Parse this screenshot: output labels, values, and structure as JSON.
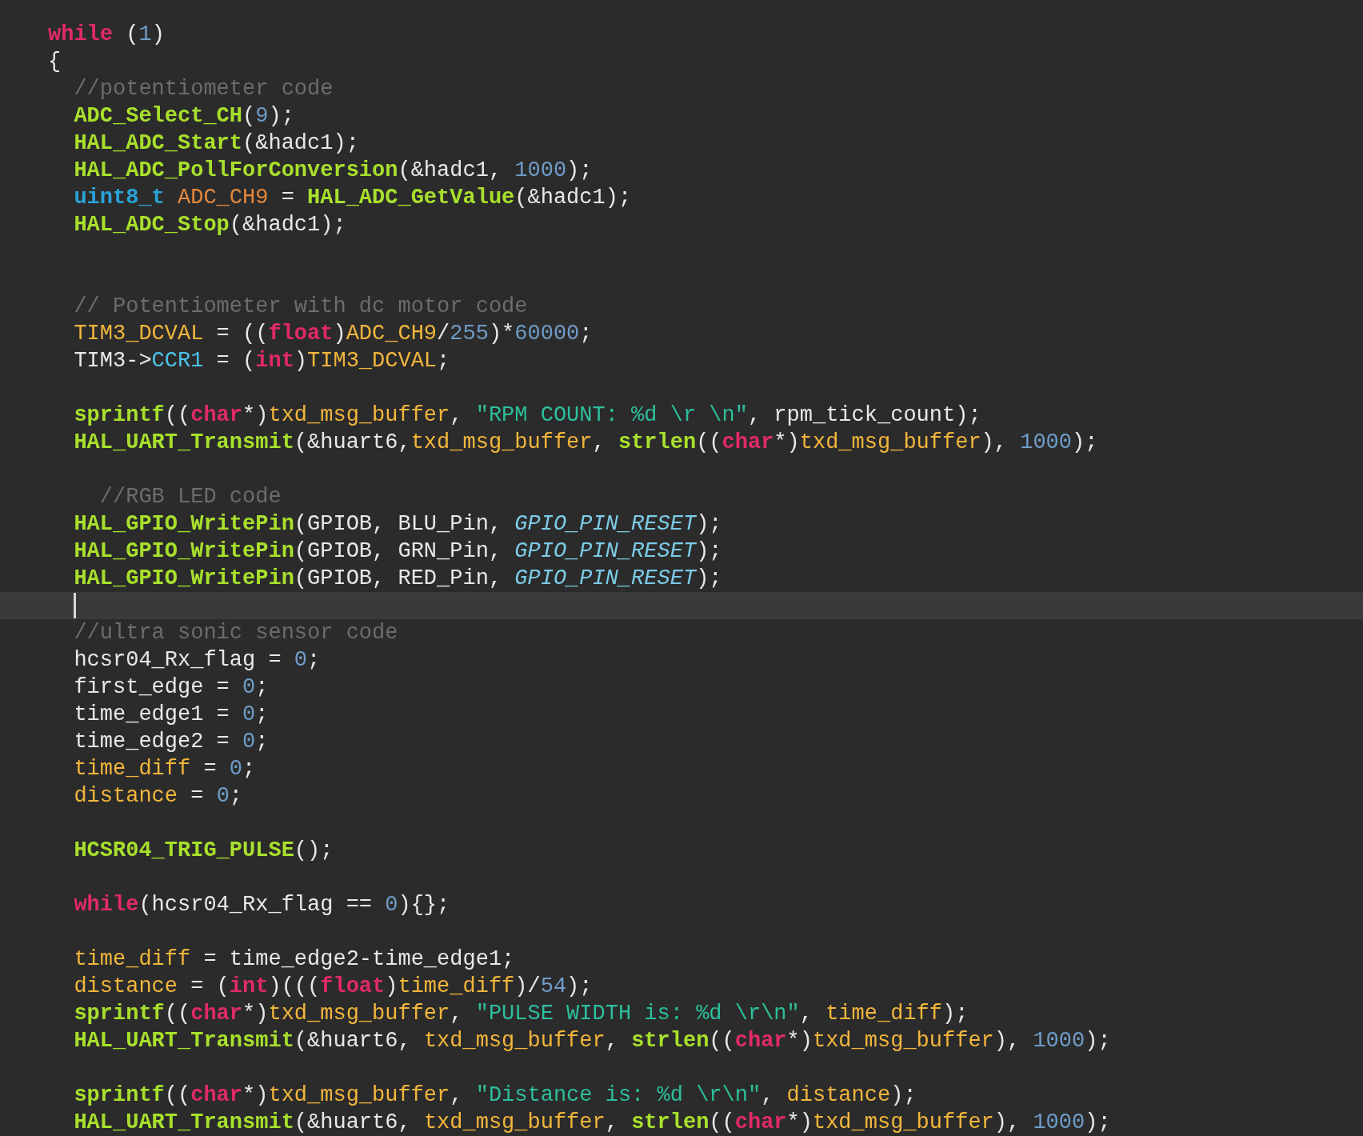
{
  "editor": {
    "lines": [
      {
        "kind": "code",
        "tokens": [
          {
            "text": "while",
            "kind": "keyword"
          },
          {
            "text": " (",
            "kind": "plain"
          },
          {
            "text": "1",
            "kind": "number"
          },
          {
            "text": ")",
            "kind": "plain"
          }
        ]
      },
      {
        "kind": "code",
        "tokens": [
          {
            "text": "{",
            "kind": "plain"
          }
        ],
        "children": [
          {
            "kind": "code",
            "tokens": [
              {
                "text": "//potentiometer code",
                "kind": "comment"
              }
            ]
          },
          {
            "kind": "code",
            "tokens": [
              {
                "text": "ADC_Select_CH",
                "kind": "function"
              },
              {
                "text": "(",
                "kind": "plain"
              },
              {
                "text": "9",
                "kind": "number"
              },
              {
                "text": ");",
                "kind": "plain"
              }
            ]
          },
          {
            "kind": "code",
            "tokens": [
              {
                "text": "HAL_ADC_Start",
                "kind": "function"
              },
              {
                "text": "(&hadc1);",
                "kind": "plain"
              }
            ]
          },
          {
            "kind": "code",
            "tokens": [
              {
                "text": "HAL_ADC_PollForConversion",
                "kind": "function"
              },
              {
                "text": "(&hadc1, ",
                "kind": "plain"
              },
              {
                "text": "1000",
                "kind": "number"
              },
              {
                "text": ");",
                "kind": "plain"
              }
            ]
          },
          {
            "kind": "code",
            "tokens": [
              {
                "text": "uint8_t",
                "kind": "type"
              },
              {
                "text": " ADC_CH9",
                "kind": "local"
              },
              {
                "text": " = ",
                "kind": "plain"
              },
              {
                "text": "HAL_ADC_GetValue",
                "kind": "function"
              },
              {
                "text": "(&hadc1);",
                "kind": "plain"
              }
            ]
          },
          {
            "kind": "code",
            "tokens": [
              {
                "text": "HAL_ADC_Stop",
                "kind": "function"
              },
              {
                "text": "(&hadc1);",
                "kind": "plain"
              }
            ]
          },
          {
            "kind": "blank"
          },
          {
            "kind": "blank"
          },
          {
            "kind": "code",
            "tokens": [
              {
                "text": "// Potentiometer with dc motor code",
                "kind": "comment"
              }
            ]
          },
          {
            "kind": "code",
            "tokens": [
              {
                "text": "TIM3_DCVAL",
                "kind": "global"
              },
              {
                "text": " = ((",
                "kind": "plain"
              },
              {
                "text": "float",
                "kind": "keyword"
              },
              {
                "text": ")",
                "kind": "plain"
              },
              {
                "text": "ADC_CH9",
                "kind": "global"
              },
              {
                "text": "/",
                "kind": "plain"
              },
              {
                "text": "255",
                "kind": "number"
              },
              {
                "text": ")*",
                "kind": "plain"
              },
              {
                "text": "60000",
                "kind": "number"
              },
              {
                "text": ";",
                "kind": "plain"
              }
            ]
          },
          {
            "kind": "code",
            "tokens": [
              {
                "text": "TIM3->",
                "kind": "plain"
              },
              {
                "text": "CCR1",
                "kind": "field"
              },
              {
                "text": " = (",
                "kind": "plain"
              },
              {
                "text": "int",
                "kind": "keyword"
              },
              {
                "text": ")",
                "kind": "plain"
              },
              {
                "text": "TIM3_DCVAL",
                "kind": "global"
              },
              {
                "text": ";",
                "kind": "plain"
              }
            ]
          },
          {
            "kind": "blank"
          },
          {
            "kind": "code",
            "tokens": [
              {
                "text": "sprintf",
                "kind": "function"
              },
              {
                "text": "((",
                "kind": "plain"
              },
              {
                "text": "char",
                "kind": "keyword"
              },
              {
                "text": "*)",
                "kind": "plain"
              },
              {
                "text": "txd_msg_buffer",
                "kind": "global"
              },
              {
                "text": ", ",
                "kind": "plain"
              },
              {
                "text": "\"RPM COUNT: %d \\r \\n\"",
                "kind": "string"
              },
              {
                "text": ", rpm_tick_count);",
                "kind": "plain"
              }
            ]
          },
          {
            "kind": "code",
            "tokens": [
              {
                "text": "HAL_UART_Transmit",
                "kind": "function"
              },
              {
                "text": "(&huart6,",
                "kind": "plain"
              },
              {
                "text": "txd_msg_buffer",
                "kind": "global"
              },
              {
                "text": ", ",
                "kind": "plain"
              },
              {
                "text": "strlen",
                "kind": "function"
              },
              {
                "text": "((",
                "kind": "plain"
              },
              {
                "text": "char",
                "kind": "keyword"
              },
              {
                "text": "*)",
                "kind": "plain"
              },
              {
                "text": "txd_msg_buffer",
                "kind": "global"
              },
              {
                "text": "), ",
                "kind": "plain"
              },
              {
                "text": "1000",
                "kind": "number"
              },
              {
                "text": ");",
                "kind": "plain"
              }
            ]
          },
          {
            "kind": "blank"
          },
          {
            "kind": "code",
            "extra_indent": true,
            "tokens": [
              {
                "text": "//RGB LED code",
                "kind": "comment"
              }
            ]
          },
          {
            "kind": "code",
            "tokens": [
              {
                "text": "HAL_GPIO_WritePin",
                "kind": "function"
              },
              {
                "text": "(GPIOB, BLU_Pin, ",
                "kind": "plain"
              },
              {
                "text": "GPIO_PIN_RESET",
                "kind": "constant"
              },
              {
                "text": ");",
                "kind": "plain"
              }
            ]
          },
          {
            "kind": "code",
            "tokens": [
              {
                "text": "HAL_GPIO_WritePin",
                "kind": "function"
              },
              {
                "text": "(GPIOB, GRN_Pin, ",
                "kind": "plain"
              },
              {
                "text": "GPIO_PIN_RESET",
                "kind": "constant"
              },
              {
                "text": ");",
                "kind": "plain"
              }
            ]
          },
          {
            "kind": "code",
            "tokens": [
              {
                "text": "HAL_GPIO_WritePin",
                "kind": "function"
              },
              {
                "text": "(GPIOB, RED_Pin, ",
                "kind": "plain"
              },
              {
                "text": "GPIO_PIN_RESET",
                "kind": "constant"
              },
              {
                "text": ");",
                "kind": "plain"
              }
            ]
          },
          {
            "kind": "cursor"
          },
          {
            "kind": "code",
            "tokens": [
              {
                "text": "//ultra sonic sensor code",
                "kind": "comment"
              }
            ]
          },
          {
            "kind": "code",
            "tokens": [
              {
                "text": "hcsr04_Rx_flag = ",
                "kind": "plain"
              },
              {
                "text": "0",
                "kind": "number"
              },
              {
                "text": ";",
                "kind": "plain"
              }
            ]
          },
          {
            "kind": "code",
            "tokens": [
              {
                "text": "first_edge = ",
                "kind": "plain"
              },
              {
                "text": "0",
                "kind": "number"
              },
              {
                "text": ";",
                "kind": "plain"
              }
            ]
          },
          {
            "kind": "code",
            "tokens": [
              {
                "text": "time_edge1 = ",
                "kind": "plain"
              },
              {
                "text": "0",
                "kind": "number"
              },
              {
                "text": ";",
                "kind": "plain"
              }
            ]
          },
          {
            "kind": "code",
            "tokens": [
              {
                "text": "time_edge2 = ",
                "kind": "plain"
              },
              {
                "text": "0",
                "kind": "number"
              },
              {
                "text": ";",
                "kind": "plain"
              }
            ]
          },
          {
            "kind": "code",
            "tokens": [
              {
                "text": "time_diff",
                "kind": "global"
              },
              {
                "text": " = ",
                "kind": "plain"
              },
              {
                "text": "0",
                "kind": "number"
              },
              {
                "text": ";",
                "kind": "plain"
              }
            ]
          },
          {
            "kind": "code",
            "tokens": [
              {
                "text": "distance",
                "kind": "global"
              },
              {
                "text": " = ",
                "kind": "plain"
              },
              {
                "text": "0",
                "kind": "number"
              },
              {
                "text": ";",
                "kind": "plain"
              }
            ]
          },
          {
            "kind": "blank"
          },
          {
            "kind": "code",
            "tokens": [
              {
                "text": "HCSR04_TRIG_PULSE",
                "kind": "function"
              },
              {
                "text": "();",
                "kind": "plain"
              }
            ]
          },
          {
            "kind": "blank"
          },
          {
            "kind": "code",
            "tokens": [
              {
                "text": "while",
                "kind": "keyword"
              },
              {
                "text": "(hcsr04_Rx_flag == ",
                "kind": "plain"
              },
              {
                "text": "0",
                "kind": "number"
              },
              {
                "text": "){};",
                "kind": "plain"
              }
            ]
          },
          {
            "kind": "blank"
          },
          {
            "kind": "code",
            "tokens": [
              {
                "text": "time_diff",
                "kind": "global"
              },
              {
                "text": " = time_edge2-time_edge1;",
                "kind": "plain"
              }
            ]
          },
          {
            "kind": "code",
            "tokens": [
              {
                "text": "distance",
                "kind": "global"
              },
              {
                "text": " = (",
                "kind": "plain"
              },
              {
                "text": "int",
                "kind": "keyword"
              },
              {
                "text": ")(((",
                "kind": "plain"
              },
              {
                "text": "float",
                "kind": "keyword"
              },
              {
                "text": ")",
                "kind": "plain"
              },
              {
                "text": "time_diff",
                "kind": "global"
              },
              {
                "text": ")/",
                "kind": "plain"
              },
              {
                "text": "54",
                "kind": "number"
              },
              {
                "text": ");",
                "kind": "plain"
              }
            ]
          },
          {
            "kind": "code",
            "tokens": [
              {
                "text": "sprintf",
                "kind": "function"
              },
              {
                "text": "((",
                "kind": "plain"
              },
              {
                "text": "char",
                "kind": "keyword"
              },
              {
                "text": "*)",
                "kind": "plain"
              },
              {
                "text": "txd_msg_buffer",
                "kind": "global"
              },
              {
                "text": ", ",
                "kind": "plain"
              },
              {
                "text": "\"PULSE WIDTH is: %d \\r\\n\"",
                "kind": "string"
              },
              {
                "text": ", ",
                "kind": "plain"
              },
              {
                "text": "time_diff",
                "kind": "global"
              },
              {
                "text": ");",
                "kind": "plain"
              }
            ]
          },
          {
            "kind": "code",
            "tokens": [
              {
                "text": "HAL_UART_Transmit",
                "kind": "function"
              },
              {
                "text": "(&huart6, ",
                "kind": "plain"
              },
              {
                "text": "txd_msg_buffer",
                "kind": "global"
              },
              {
                "text": ", ",
                "kind": "plain"
              },
              {
                "text": "strlen",
                "kind": "function"
              },
              {
                "text": "((",
                "kind": "plain"
              },
              {
                "text": "char",
                "kind": "keyword"
              },
              {
                "text": "*)",
                "kind": "plain"
              },
              {
                "text": "txd_msg_buffer",
                "kind": "global"
              },
              {
                "text": "), ",
                "kind": "plain"
              },
              {
                "text": "1000",
                "kind": "number"
              },
              {
                "text": ");",
                "kind": "plain"
              }
            ]
          },
          {
            "kind": "blank"
          },
          {
            "kind": "code",
            "tokens": [
              {
                "text": "sprintf",
                "kind": "function"
              },
              {
                "text": "((",
                "kind": "plain"
              },
              {
                "text": "char",
                "kind": "keyword"
              },
              {
                "text": "*)",
                "kind": "plain"
              },
              {
                "text": "txd_msg_buffer",
                "kind": "global"
              },
              {
                "text": ", ",
                "kind": "plain"
              },
              {
                "text": "\"Distance is: %d \\r\\n\"",
                "kind": "string"
              },
              {
                "text": ", ",
                "kind": "plain"
              },
              {
                "text": "distance",
                "kind": "global"
              },
              {
                "text": ");",
                "kind": "plain"
              }
            ]
          },
          {
            "kind": "code",
            "tokens": [
              {
                "text": "HAL_UART_Transmit",
                "kind": "function"
              },
              {
                "text": "(&huart6, ",
                "kind": "plain"
              },
              {
                "text": "txd_msg_buffer",
                "kind": "global"
              },
              {
                "text": ", ",
                "kind": "plain"
              },
              {
                "text": "strlen",
                "kind": "function"
              },
              {
                "text": "((",
                "kind": "plain"
              },
              {
                "text": "char",
                "kind": "keyword"
              },
              {
                "text": "*)",
                "kind": "plain"
              },
              {
                "text": "txd_msg_buffer",
                "kind": "global"
              },
              {
                "text": "), ",
                "kind": "plain"
              },
              {
                "text": "1000",
                "kind": "number"
              },
              {
                "text": ");",
                "kind": "plain"
              }
            ]
          }
        ]
      }
    ]
  }
}
